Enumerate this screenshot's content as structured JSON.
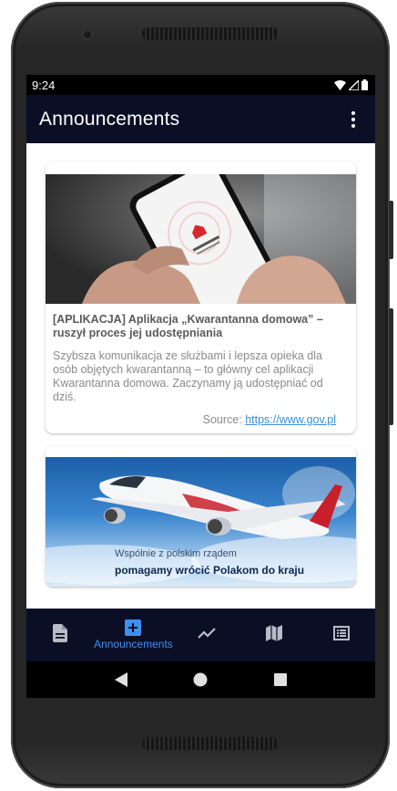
{
  "status_bar": {
    "time": "9:24",
    "icons": [
      "wifi-icon",
      "signal-icon",
      "battery-icon"
    ]
  },
  "app_bar": {
    "title": "Announcements",
    "overflow_icon": "more-vert-icon"
  },
  "announcements": [
    {
      "image": "phone-app-photo",
      "title": "[APLIKACJA] Aplikacja „Kwarantanna domowa” – ruszył proces jej udostępniania",
      "description": "Szybsza komunikacja ze służbami i lepsza opieka dla osób objętych kwarantanną – to główny cel aplikacji Kwarantanna domowa. Zaczynamy ją udostępniać od dziś.",
      "source_label": "Source: ",
      "source_link": "https://www.gov.pl"
    },
    {
      "image": "airplane-photo",
      "caption_line1": "Wspólnie z polskim rządem",
      "caption_line2": "pomagamy wrócić Polakom do kraju"
    }
  ],
  "bottom_nav": {
    "items": [
      {
        "icon": "document-icon",
        "label": ""
      },
      {
        "icon": "add-box-icon",
        "label": "Announcements",
        "active": true
      },
      {
        "icon": "trending-icon",
        "label": ""
      },
      {
        "icon": "map-icon",
        "label": ""
      },
      {
        "icon": "list-alt-icon",
        "label": ""
      }
    ]
  },
  "system_nav": {
    "buttons": [
      "back-icon",
      "home-icon",
      "recents-icon"
    ]
  },
  "colors": {
    "app_bar": "#0a0f26",
    "accent": "#3d8ff0",
    "link": "#3a8fd6"
  }
}
